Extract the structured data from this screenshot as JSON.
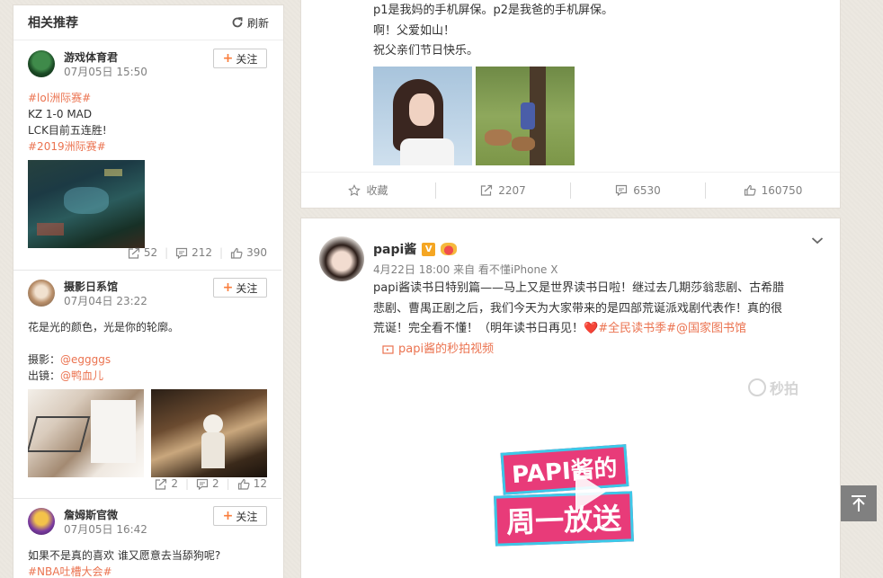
{
  "sidebar": {
    "title": "相关推荐",
    "refresh_label": "刷新",
    "follow_label": "关注",
    "cards": [
      {
        "name": "游戏体育君",
        "time": "07月05日 15:50",
        "tag1": "#lol洲际赛#",
        "line1": "KZ 1-0 MAD",
        "line2": "LCK目前五连胜!",
        "tag2": "#2019洲际赛#",
        "reposts": "52",
        "comments": "212",
        "likes": "390"
      },
      {
        "name": "摄影日系馆",
        "time": "07月04日 23:22",
        "line1": "花是光的颜色，光是你的轮廓。",
        "photo_label": "摄影：",
        "photo_user": "@eggggs",
        "model_label": "出镜：",
        "model_user": "@鸭血儿",
        "reposts": "2",
        "comments": "2",
        "likes": "12"
      },
      {
        "name": "詹姆斯官微",
        "time": "07月05日 16:42",
        "line1": "如果不是真的喜欢 谁又愿意去当舔狗呢?",
        "tag1": "#NBA吐槽大会#"
      }
    ]
  },
  "post1": {
    "line1": "p1是我妈的手机屏保。p2是我爸的手机屏保。",
    "line2": "啊！父爱如山！",
    "line3": "祝父亲们节日快乐。",
    "favorite_label": "收藏",
    "reposts": "2207",
    "comments": "6530",
    "likes": "160750"
  },
  "post2": {
    "name": "papi酱",
    "verified_badge": "V",
    "meta": "4月22日 18:00 来自 看不懂iPhone X",
    "text1": "papi酱读书日特别篇——马上又是世界读书日啦！继过去几期莎翁悲剧、古希腊",
    "text2": "悲剧、曹禺正剧之后，我们今天为大家带来的是四部荒诞派戏剧代表作！真的很",
    "text3": "荒诞！完全看不懂！（明年读书日再见！",
    "tag1": "#全民读书季#",
    "mention": "@国家图书馆",
    "video_link": "papi酱的秒拍视频",
    "watermark": "秒拍",
    "video_title_1": "PAPI酱的",
    "video_title_2": "周一放送"
  },
  "colors": {
    "link": "#eb7350",
    "accent": "#fa7d3c"
  }
}
